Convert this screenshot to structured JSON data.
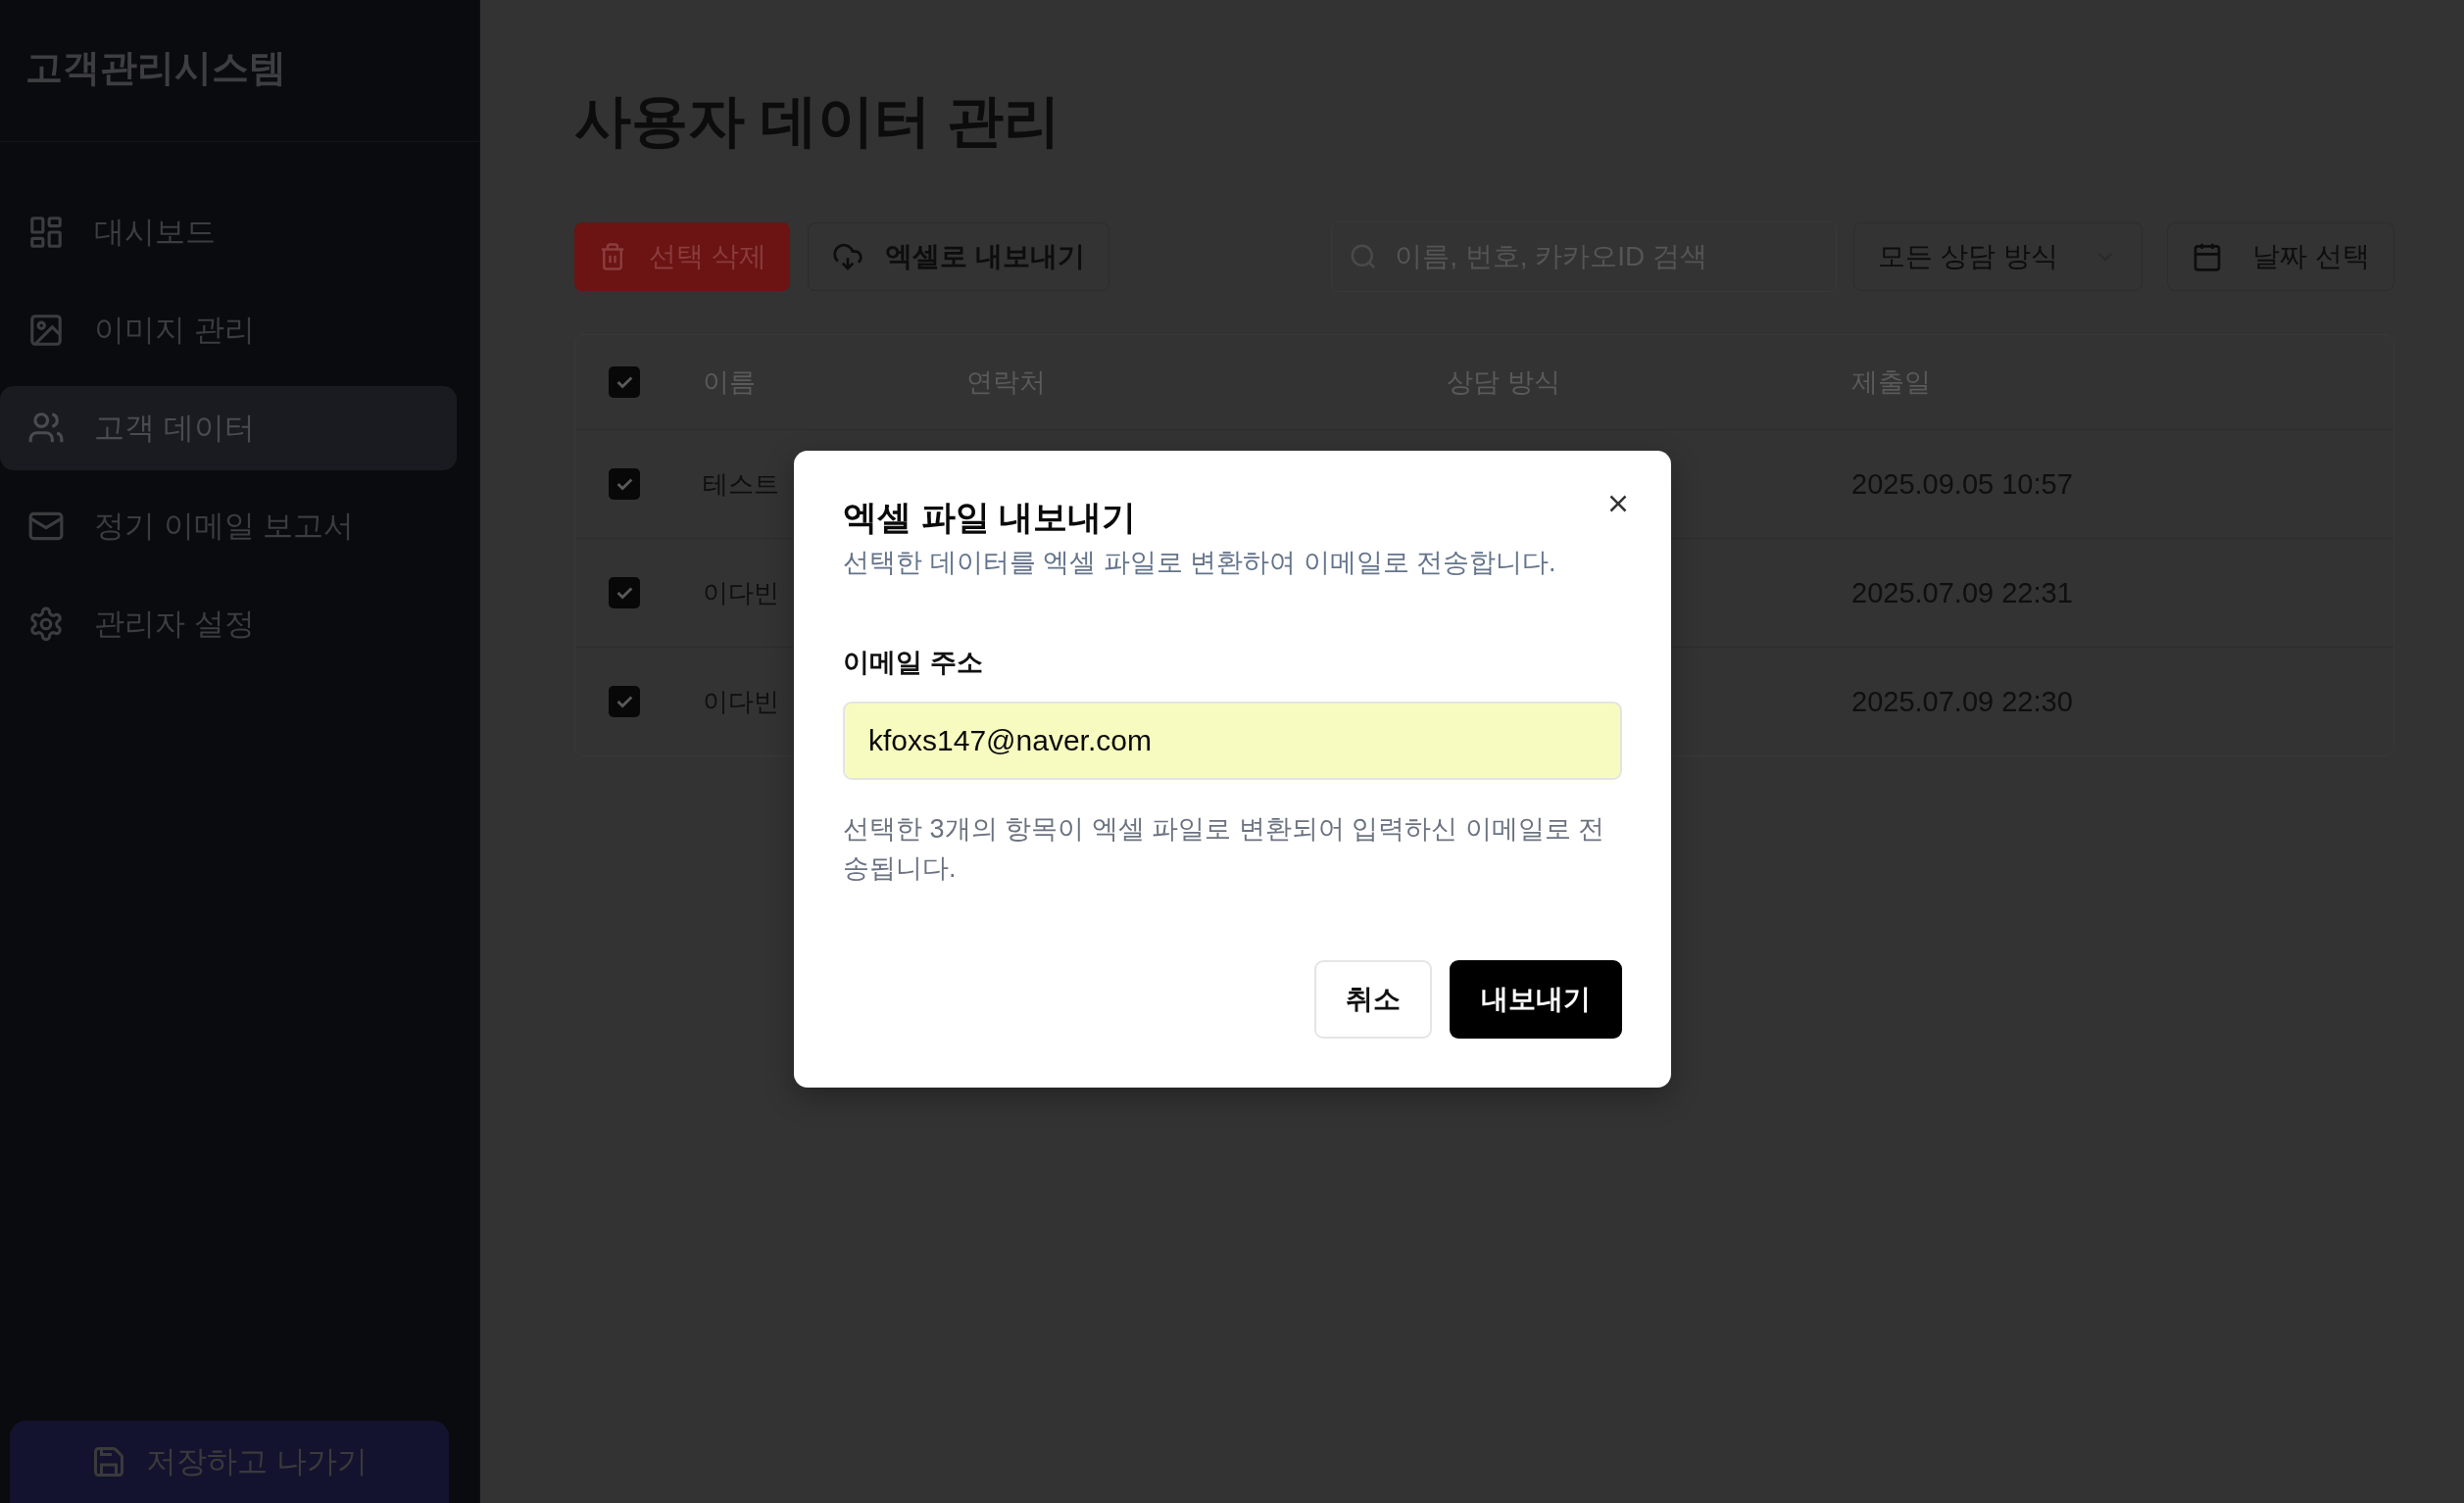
{
  "sidebar": {
    "title": "고객관리시스템",
    "items": [
      {
        "label": "대시보드",
        "selected": false
      },
      {
        "label": "이미지 관리",
        "selected": false
      },
      {
        "label": "고객 데이터",
        "selected": true
      },
      {
        "label": "정기 이메일 보고서",
        "selected": false
      },
      {
        "label": "관리자 설정",
        "selected": false
      }
    ],
    "save_button": "저장하고 나가기"
  },
  "main": {
    "title": "사용자 데이터 관리",
    "toolbar": {
      "delete_button": "선택 삭제",
      "export_button": "엑셀로 내보내기",
      "search": {
        "placeholder": "이름, 번호, 카카오ID 검색"
      },
      "method_select": "모든 상담 방식",
      "date_button": "날짜 선택"
    },
    "table": {
      "all_checked": true,
      "columns": [
        "이름",
        "연락처",
        "상담 방식",
        "제출일"
      ],
      "rows": [
        {
          "checked": true,
          "name": "테스트",
          "date": "2025.09.05 10:57"
        },
        {
          "checked": true,
          "name": "이다빈",
          "date": "2025.07.09 22:31"
        },
        {
          "checked": true,
          "name": "이다빈",
          "date": "2025.07.09 22:30"
        }
      ]
    }
  },
  "dialog": {
    "title": "엑셀 파일 내보내기",
    "description": "선택한 데이터를 엑셀 파일로 변환하여 이메일로 전송합니다.",
    "email_label": "이메일 주소",
    "email_value": "kfoxs147@naver.com",
    "note": "선택한 3개의 항목이 엑셀 파일로 변환되어 입력하신 이메일로 전송됩니다.",
    "buttons": [
      {
        "label": "취소",
        "kind": "secondary"
      },
      {
        "label": "내보내기",
        "kind": "primary"
      }
    ]
  }
}
